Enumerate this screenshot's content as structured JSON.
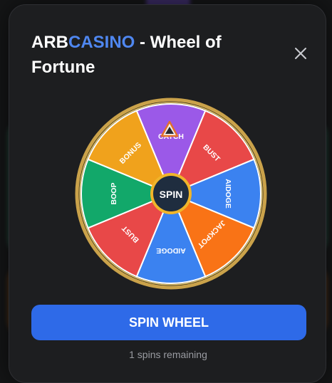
{
  "modal": {
    "title_brand_prefix": "ARB",
    "title_brand_accent": "CASINO",
    "title_rest": " - Wheel of Fortune",
    "close_icon": "close-icon",
    "hub_label": "SPIN",
    "spin_button_label": "SPIN WHEEL",
    "spins_remaining_count": "1",
    "spins_remaining_suffix": " spins remaining"
  },
  "wheel": {
    "pointer_icon": "triangle-pointer-icon",
    "segments": [
      {
        "label": "CATCH",
        "color": "#9b59e8"
      },
      {
        "label": "BUST",
        "color": "#e84848"
      },
      {
        "label": "AIDOGE",
        "color": "#3b82f0"
      },
      {
        "label": "JACKPOT",
        "color": "#f97316"
      },
      {
        "label": "AIDOGE",
        "color": "#3b82f0"
      },
      {
        "label": "BUST",
        "color": "#e84848"
      },
      {
        "label": "BOOP",
        "color": "#12a86a"
      },
      {
        "label": "BONUS",
        "color": "#f0a21c"
      }
    ],
    "rim_color": "#caa24a"
  }
}
